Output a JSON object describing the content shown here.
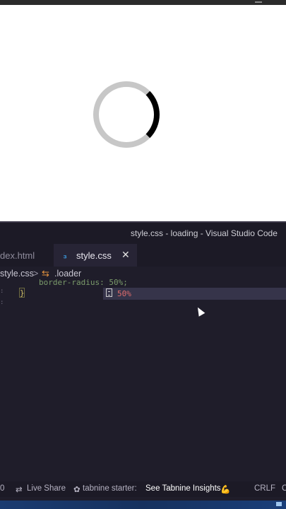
{
  "browser": {
    "loader_progress_shown": 0.25
  },
  "vscode": {
    "window_title": "style.css - loading - Visual Studio Code",
    "tabs": [
      {
        "label": "index.html",
        "visible_label": "dex.html",
        "active": false
      },
      {
        "label": "style.css",
        "active": true,
        "close_symbol": "✕"
      }
    ],
    "breadcrumb": {
      "file": "style.css",
      "separator": ">",
      "selector": ".loader"
    },
    "editor": {
      "code_line_text": "border-radius: 50%;",
      "code_line_visible": "border-radius: 50%;",
      "closing_brace": "}",
      "suggestion": "50%"
    },
    "statusbar": {
      "left_count": "0",
      "live_share": "Live Share",
      "tabnine": "tabnine starter:",
      "insights": "See Tabnine Insights",
      "insights_emoji": "💪",
      "line_ending": "CRLF",
      "trailing": "C"
    },
    "colors": {
      "editor_bg": "#1f1d2a",
      "css_icon": "#3d9fe6",
      "selector_icon": "#e4923f",
      "suggestion_text": "#e06c6c"
    }
  }
}
